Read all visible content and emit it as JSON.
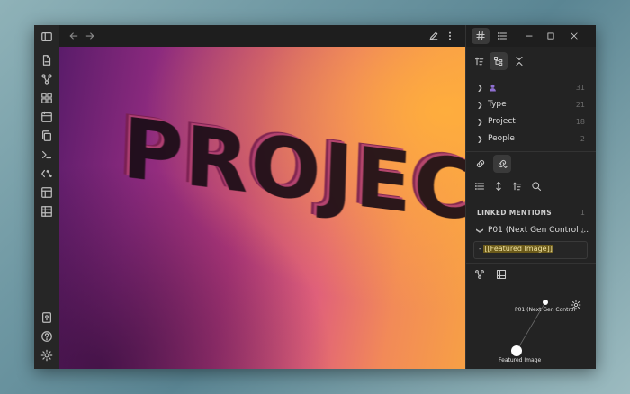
{
  "ribbon": {
    "icons": [
      "sidebar-toggle-icon",
      "new-note-icon",
      "graph-view-icon",
      "canvas-icon",
      "calendar-icon",
      "copy-icon",
      "command-icon",
      "template-icon",
      "layout-icon",
      "table-icon",
      "vault-icon",
      "help-icon",
      "settings-icon"
    ]
  },
  "hero": {
    "word": "PROJECTS"
  },
  "tags": {
    "items": [
      {
        "label": "",
        "count": "31",
        "icon": "person-icon"
      },
      {
        "label": "Type",
        "count": "21"
      },
      {
        "label": "Project",
        "count": "18"
      },
      {
        "label": "People",
        "count": "2"
      }
    ]
  },
  "backlinks": {
    "header": "LINKED MENTIONS",
    "header_count": "1",
    "file": "P01 (Next Gen Control ...",
    "file_count": "1",
    "mention_prefix": "- ",
    "mention_link": "[[Featured Image]]"
  },
  "graph": {
    "node1": "P01 (Next Gen Control",
    "node2": "Featured Image"
  },
  "colors": {
    "accent": "#7b6bd6",
    "highlight": "#6b5a1a",
    "background": "#1e1e1e"
  }
}
